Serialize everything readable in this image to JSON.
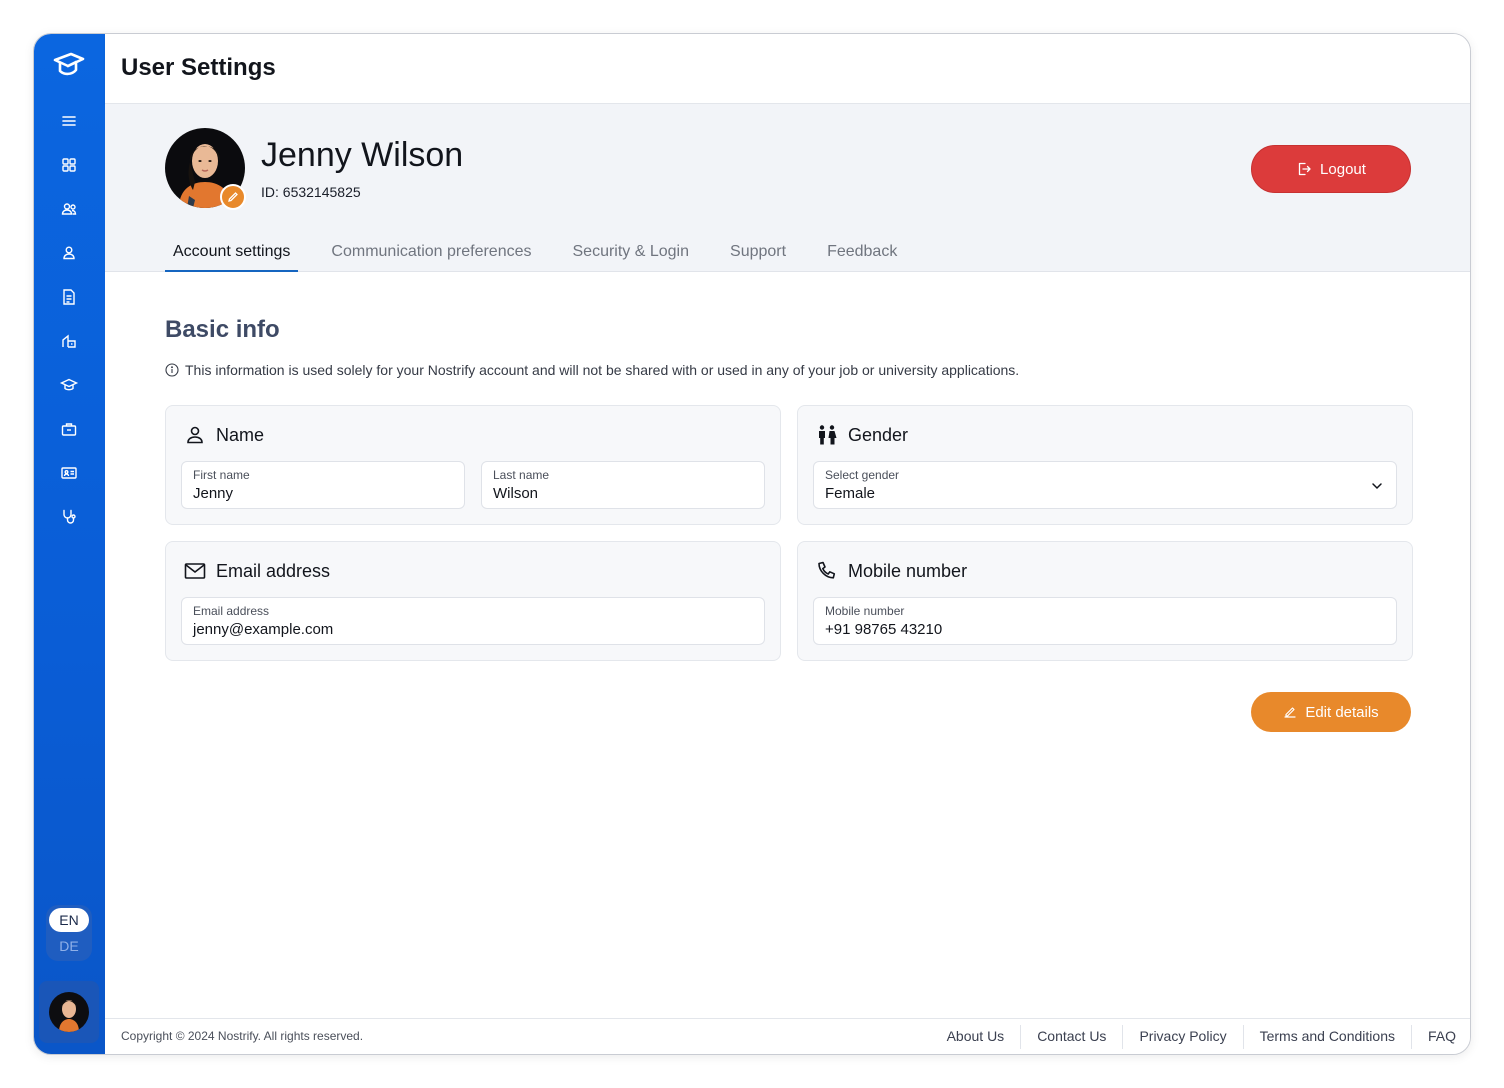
{
  "app": {
    "title": "User Settings"
  },
  "sidebar": {
    "items": [
      {
        "icon": "menu-icon"
      },
      {
        "icon": "dashboard-grid-icon"
      },
      {
        "icon": "users-icon"
      },
      {
        "icon": "user-icon"
      },
      {
        "icon": "document-icon"
      },
      {
        "icon": "building-icon"
      },
      {
        "icon": "graduation-cap-icon"
      },
      {
        "icon": "briefcase-icon"
      },
      {
        "icon": "id-card-icon"
      },
      {
        "icon": "stethoscope-icon"
      }
    ],
    "lang_en": "EN",
    "lang_de": "DE"
  },
  "profile": {
    "name": "Jenny Wilson",
    "id_text": "ID: 6532145825",
    "logout_label": "Logout"
  },
  "tabs": [
    {
      "label": "Account settings",
      "active": true
    },
    {
      "label": "Communication preferences",
      "active": false
    },
    {
      "label": "Security & Login",
      "active": false
    },
    {
      "label": "Support",
      "active": false
    },
    {
      "label": "Feedback",
      "active": false
    }
  ],
  "basic_info": {
    "title": "Basic info",
    "notice": "This information is used solely for your Nostrify account and will not be shared with or used in any of your job or university applications.",
    "name_card": {
      "title": "Name",
      "first_label": "First name",
      "first_value": "Jenny",
      "last_label": "Last name",
      "last_value": "Wilson"
    },
    "gender_card": {
      "title": "Gender",
      "select_label": "Select gender",
      "select_value": "Female"
    },
    "email_card": {
      "title": "Email address",
      "label": "Email address",
      "value": "jenny@example.com"
    },
    "mobile_card": {
      "title": "Mobile number",
      "label": "Mobile number",
      "value": "+91 98765 43210"
    },
    "edit_label": "Edit details"
  },
  "footer": {
    "copyright": "Copyright © 2024 Nostrify. All rights reserved.",
    "links": [
      "About Us",
      "Contact Us",
      "Privacy Policy",
      "Terms and Conditions",
      "FAQ"
    ]
  },
  "colors": {
    "sidebar": "#0b66e0",
    "logout": "#dc3b3b",
    "edit": "#e8892b",
    "tab_underline": "#1565c0"
  }
}
